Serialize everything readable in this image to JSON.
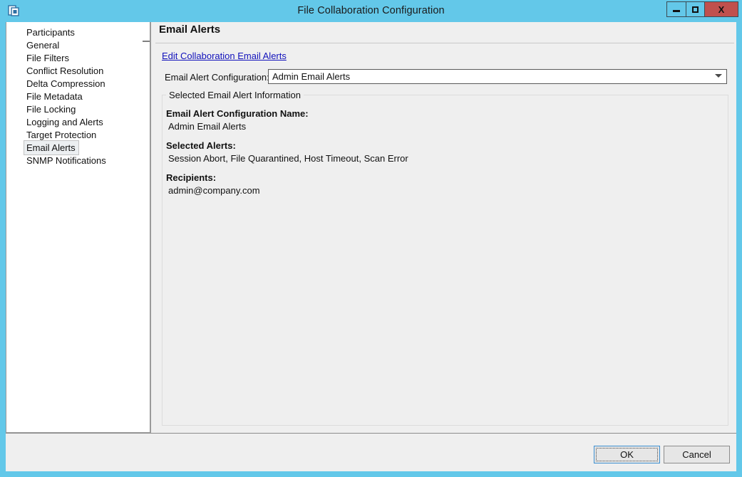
{
  "window": {
    "title": "File Collaboration Configuration",
    "icon": "collaboration-windows-icon",
    "controls": {
      "minimize": "minimize-icon",
      "maximize": "maximize-icon",
      "close_label": "X"
    },
    "titlebar_color": "#63c8e9",
    "close_color": "#c0504d"
  },
  "sidebar": {
    "items": [
      {
        "label": "Participants",
        "selected": false
      },
      {
        "label": "General",
        "selected": false
      },
      {
        "label": "File Filters",
        "selected": false
      },
      {
        "label": "Conflict Resolution",
        "selected": false
      },
      {
        "label": "Delta Compression",
        "selected": false
      },
      {
        "label": "File Metadata",
        "selected": false
      },
      {
        "label": "File Locking",
        "selected": false
      },
      {
        "label": "Logging and Alerts",
        "selected": false
      },
      {
        "label": "Target Protection",
        "selected": false
      },
      {
        "label": "Email Alerts",
        "selected": true
      },
      {
        "label": "SNMP Notifications",
        "selected": false
      }
    ]
  },
  "main": {
    "page_title": "Email Alerts",
    "edit_link": "Edit Collaboration Email Alerts",
    "combo_label": "Email Alert Configuration:",
    "combo_value": "Admin Email Alerts",
    "combo_options": [
      "Admin Email Alerts"
    ],
    "group": {
      "legend": "Selected Email Alert Information",
      "name_heading": "Email Alert Configuration Name:",
      "name_value": "Admin Email Alerts",
      "alerts_heading": "Selected Alerts:",
      "alerts_value": "Session Abort, File Quarantined, Host Timeout, Scan Error",
      "recipients_heading": "Recipients:",
      "recipients_value": "admin@company.com"
    }
  },
  "footer": {
    "ok_label": "OK",
    "cancel_label": "Cancel"
  }
}
